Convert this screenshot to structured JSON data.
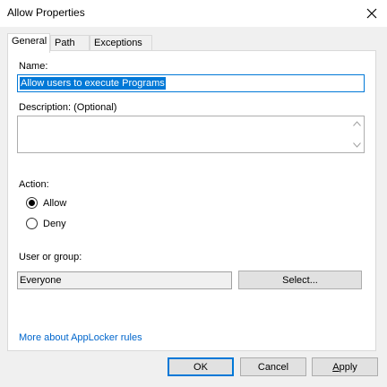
{
  "window": {
    "title": "Allow Properties",
    "close_icon": "close-icon"
  },
  "tabs": [
    {
      "label": "General",
      "active": true
    },
    {
      "label": "Path",
      "active": false
    },
    {
      "label": "Exceptions",
      "active": false
    }
  ],
  "general": {
    "name_label": "Name:",
    "name_value": "Allow users to execute Programs",
    "description_label": "Description: (Optional)",
    "description_value": "",
    "action_label": "Action:",
    "action_options": [
      {
        "label": "Allow",
        "checked": true
      },
      {
        "label": "Deny",
        "checked": false
      }
    ],
    "user_group_label": "User or group:",
    "user_group_value": "Everyone",
    "select_button": "Select...",
    "help_link": "More about AppLocker rules"
  },
  "footer": {
    "ok": "OK",
    "cancel": "Cancel",
    "apply": "Apply"
  },
  "colors": {
    "accent": "#0078d7",
    "link": "#0066cc",
    "dialog_bg": "#f0f0f0",
    "panel_bg": "#ffffff"
  }
}
